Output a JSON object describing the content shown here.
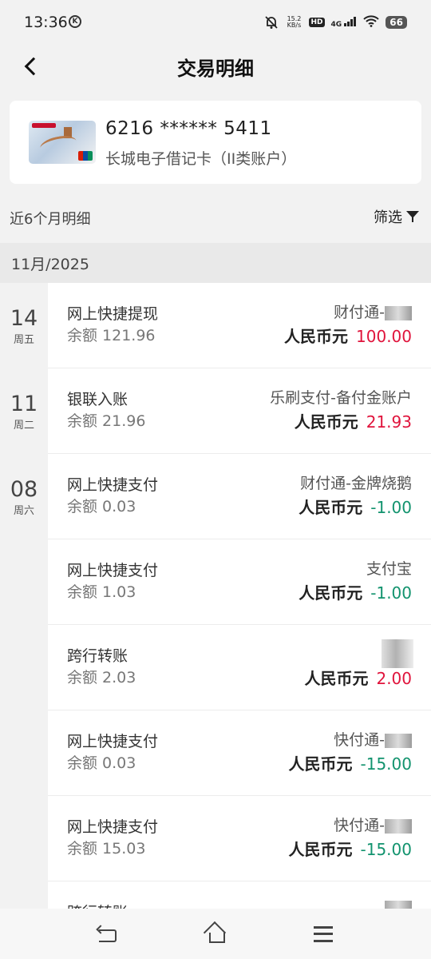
{
  "status_bar": {
    "time": "13:36",
    "speed_value": "15.2",
    "speed_unit": "KB/s",
    "hd": "HD",
    "signal": "4G",
    "battery": "66"
  },
  "nav": {
    "title": "交易明细"
  },
  "card": {
    "number": "6216 ****** 5411",
    "name": "长城电子借记卡（II类账户）"
  },
  "filter": {
    "label": "近6个月明细",
    "button": "筛选"
  },
  "month": "11月/2025",
  "dates": [
    {
      "day": "14",
      "weekday": "周五"
    },
    {
      "day": "11",
      "weekday": "周二"
    },
    {
      "day": "08",
      "weekday": "周六"
    }
  ],
  "balance_label": "余额",
  "currency": "人民币元",
  "transactions": [
    {
      "title": "网上快捷提现",
      "balance": "121.96",
      "counterparty": "财付通-",
      "amount": "100.00",
      "type": "income"
    },
    {
      "title": "银联入账",
      "balance": "21.96",
      "counterparty": "乐刷支付-备付金账户",
      "amount": "21.93",
      "type": "income"
    },
    {
      "title": "网上快捷支付",
      "balance": "0.03",
      "counterparty": "财付通-金牌烧鹅",
      "amount": "-1.00",
      "type": "expense"
    },
    {
      "title": "网上快捷支付",
      "balance": "1.03",
      "counterparty": "支付宝",
      "amount": "-1.00",
      "type": "expense"
    },
    {
      "title": "跨行转账",
      "balance": "2.03",
      "counterparty": "",
      "amount": "2.00",
      "type": "income"
    },
    {
      "title": "网上快捷支付",
      "balance": "0.03",
      "counterparty": "快付通-",
      "amount": "-15.00",
      "type": "expense"
    },
    {
      "title": "网上快捷支付",
      "balance": "15.03",
      "counterparty": "快付通-",
      "amount": "-15.00",
      "type": "expense"
    },
    {
      "title": "跨行转账",
      "balance": "",
      "counterparty": "",
      "amount": "",
      "type": "income"
    }
  ],
  "colors": {
    "income": "#e0143c",
    "expense": "#12936e"
  }
}
